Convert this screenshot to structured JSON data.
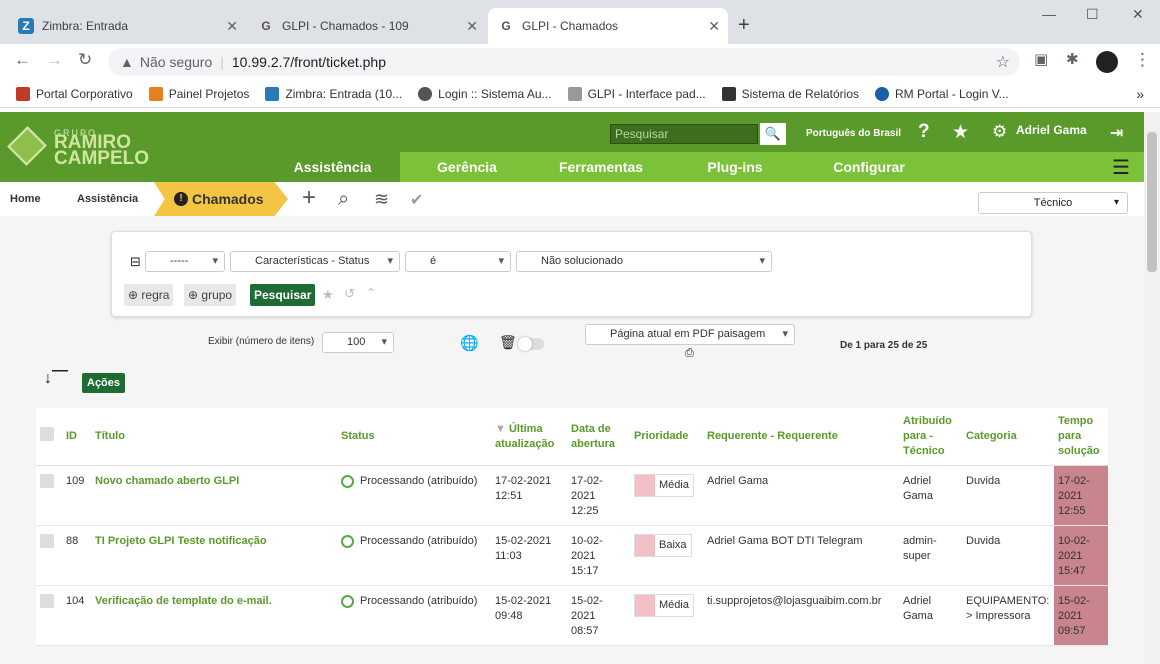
{
  "browser": {
    "tabs": [
      {
        "title": "Zimbra: Entrada",
        "icon": "zimbra-icon"
      },
      {
        "title": "GLPI - Chamados - 109",
        "icon": "glpi-icon"
      },
      {
        "title": "GLPI - Chamados",
        "icon": "glpi-icon"
      }
    ],
    "security": "Não seguro",
    "url": "10.99.2.7/front/ticket.php",
    "bookmarks": [
      "Portal Corporativo",
      "Painel Projetos",
      "Zimbra: Entrada (10...",
      "Login :: Sistema Au...",
      "GLPI - Interface pad...",
      "Sistema de Relatórios",
      "RM Portal - Login V..."
    ],
    "more": "»"
  },
  "header": {
    "logo_small": "GRUPO",
    "logo_line1": "RAMIRO",
    "logo_line2": "CAMPELO",
    "search_placeholder": "Pesquisar",
    "language": "Português do Brasil",
    "user": "Adriel Gama",
    "menu": [
      "Assistência",
      "Gerência",
      "Ferramentas",
      "Plug-ins",
      "Configurar"
    ]
  },
  "breadcrumb": {
    "home": "Home",
    "section": "Assistência",
    "current": "Chamados"
  },
  "profile": "Técnico",
  "search": {
    "field_link": "-----",
    "field_criteria": "Características - Status",
    "field_operator": "é",
    "field_value": "Não solucionado",
    "rule_btn": "regra",
    "group_btn": "grupo",
    "search_btn": "Pesquisar"
  },
  "listing": {
    "display_label": "Exibir (número de itens)",
    "display_value": "100",
    "export_option": "Página atual em PDF paisagem",
    "pagination": "De 1 para 25 de 25",
    "actions_btn": "Ações"
  },
  "table": {
    "headers": {
      "id": "ID",
      "title": "Título",
      "status": "Status",
      "updated": "Última atualização",
      "opened": "Data de abertura",
      "priority": "Prioridade",
      "requester": "Requerente - Requerente",
      "assigned": "Atribuído para - Técnico",
      "category": "Categoria",
      "time": "Tempo para solução"
    },
    "rows": [
      {
        "id": "109",
        "title": "Novo chamado aberto GLPI",
        "status": "Processando (atribuído)",
        "updated": "17-02-2021 12:51",
        "opened": "17-02-2021 12:25",
        "priority": "Média",
        "requester": "Adriel Gama",
        "assigned": "Adriel Gama",
        "category": "Duvida",
        "time": "17-02-2021 12:55"
      },
      {
        "id": "88",
        "title": "TI Projeto GLPI Teste notificação",
        "status": "Processando (atribuído)",
        "updated": "15-02-2021 11:03",
        "opened": "10-02-2021 15:17",
        "priority": "Baixa",
        "requester": "Adriel Gama BOT DTI Telegram",
        "assigned": "admin-super",
        "category": "Duvida",
        "time": "10-02-2021 15:47"
      },
      {
        "id": "104",
        "title": "Verificação de template do e-mail.",
        "status": "Processando (atribuído)",
        "updated": "15-02-2021 09:48",
        "opened": "15-02-2021 08:57",
        "priority": "Média",
        "requester": "ti.supprojetos@lojasguaibim.com.br",
        "assigned": "Adriel Gama",
        "category": "EQUIPAMENTO: > Impressora",
        "time": "15-02-2021 09:57"
      }
    ]
  },
  "colors": {
    "green_dark": "#5a9a2a",
    "green_light": "#7bc238",
    "crumb_active": "#f4c542",
    "button": "#1e6b34",
    "tempo_late": "#c9858e"
  }
}
